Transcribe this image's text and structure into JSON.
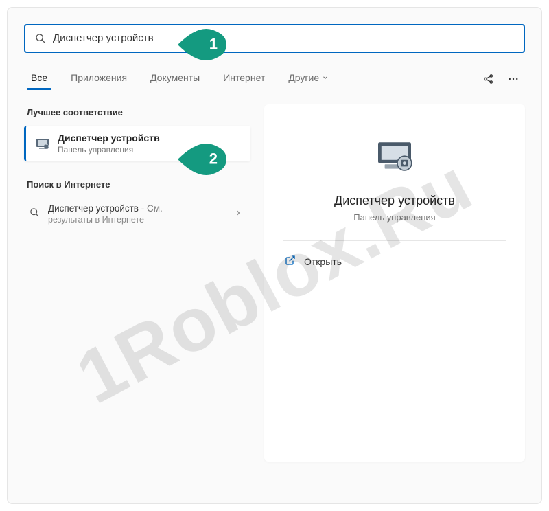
{
  "search": {
    "value": "Диспетчер устройств"
  },
  "tabs": [
    {
      "label": "Все",
      "active": true
    },
    {
      "label": "Приложения",
      "active": false
    },
    {
      "label": "Документы",
      "active": false
    },
    {
      "label": "Интернет",
      "active": false
    },
    {
      "label": "Другие",
      "active": false,
      "hasDropdown": true
    }
  ],
  "sections": {
    "bestMatch": "Лучшее соответствие",
    "webSearch": "Поиск в Интернете"
  },
  "bestMatchResult": {
    "title": "Диспетчер устройств",
    "subtitle": "Панель управления"
  },
  "webResult": {
    "title": "Диспетчер устройств",
    "suffix": " - См.",
    "subline": "результаты в Интернете"
  },
  "detail": {
    "title": "Диспетчер устройств",
    "subtitle": "Панель управления",
    "openLabel": "Открыть"
  },
  "annotations": {
    "badge1": "1",
    "badge2": "2"
  },
  "watermark": "1Roblox.Ru"
}
